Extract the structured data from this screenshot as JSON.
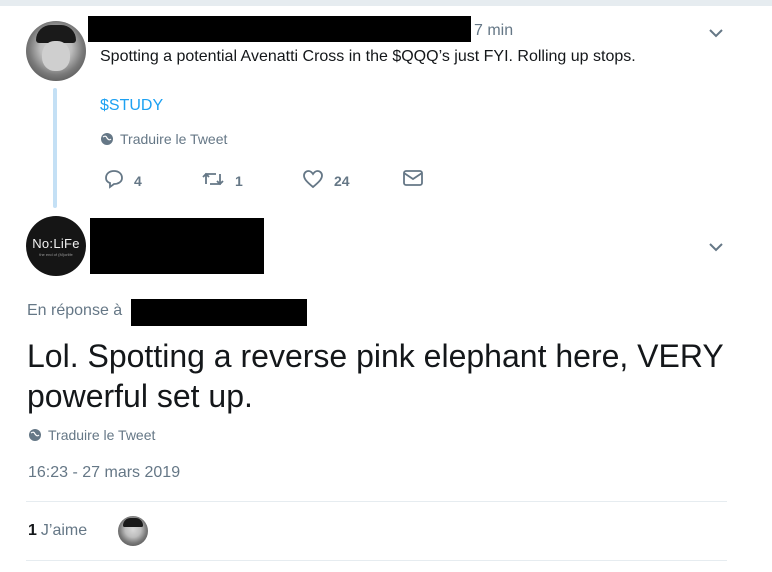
{
  "tweet1": {
    "time": "7 min",
    "text": "Spotting a potential Avenatti Cross in the $QQQ’s just FYI. Rolling up stops.",
    "cashtag": "$STUDY",
    "translate": "Traduire le Tweet",
    "replies": "4",
    "retweets": "1",
    "likes": "24"
  },
  "tweet2": {
    "avatar_logo": "No:LiFe",
    "avatar_sub": "the end of (M)orlife",
    "reply_to_label": "En réponse à",
    "text": "Lol. Spotting a reverse pink elephant here, VERY powerful set up.",
    "translate": "Traduire le Tweet",
    "timestamp": "16:23 - 27 mars 2019",
    "like_count": "1",
    "like_label": "J’aime"
  },
  "colors": {
    "link": "#1da1f2",
    "muted": "#657786",
    "thread_line": "#c4e0f5",
    "divider": "#e6ecf0"
  },
  "icons": [
    "chevron-down-icon",
    "globe-icon",
    "reply-icon",
    "retweet-icon",
    "heart-icon",
    "envelope-icon"
  ]
}
